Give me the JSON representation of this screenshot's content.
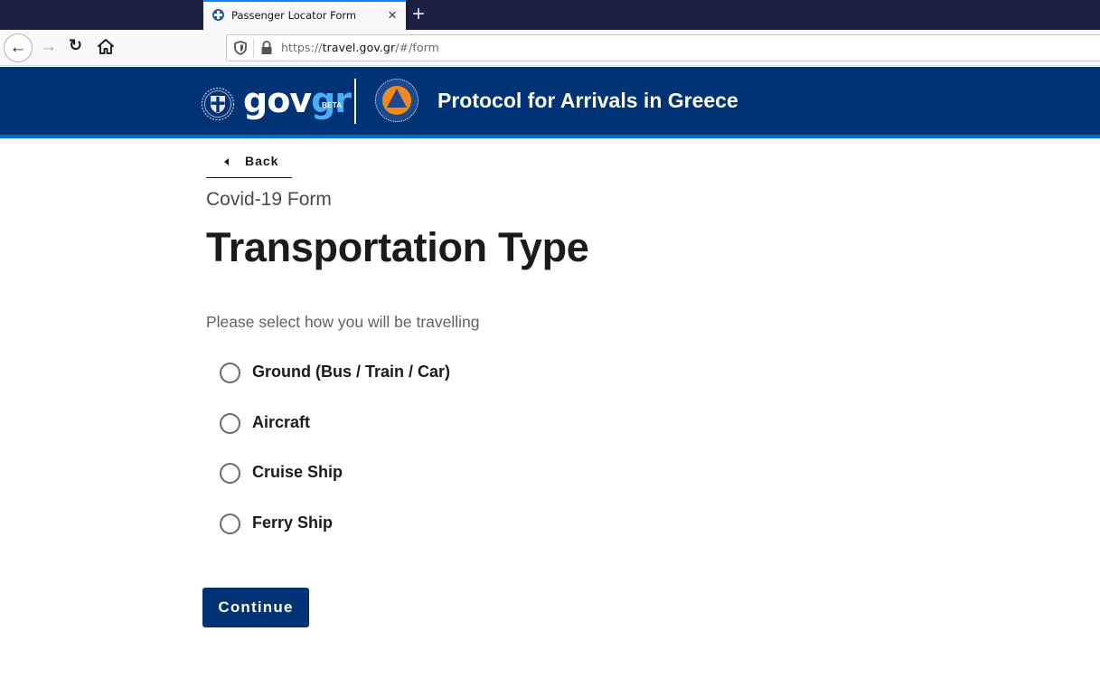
{
  "browser": {
    "tab": {
      "title": "Passenger Locator Form",
      "favicon": "greek-emblem-icon",
      "close_icon": "×"
    },
    "new_tab_icon": "+",
    "nav": {
      "back_icon": "←",
      "forward_icon": "→",
      "reload_icon": "↻",
      "home_icon": "home-icon"
    },
    "url": {
      "scheme": "https://",
      "host": "travel.gov.gr",
      "path": "/#/form"
    }
  },
  "header": {
    "brand_gov": "gov",
    "brand_gr": "gr",
    "beta_label": "BETA",
    "title": "Protocol for Arrivals in Greece",
    "colors": {
      "background": "#003375",
      "accent": "#046ec5",
      "brand_gr": "#4dabf7"
    }
  },
  "main": {
    "back_label": "Back",
    "caption": "Covid-19 Form",
    "title": "Transportation Type",
    "hint": "Please select how you will be travelling",
    "options": [
      {
        "label": "Ground (Bus / Train / Car)",
        "selected": false
      },
      {
        "label": "Aircraft",
        "selected": false
      },
      {
        "label": "Cruise Ship",
        "selected": false
      },
      {
        "label": "Ferry Ship",
        "selected": false
      }
    ],
    "continue_label": "Continue"
  }
}
